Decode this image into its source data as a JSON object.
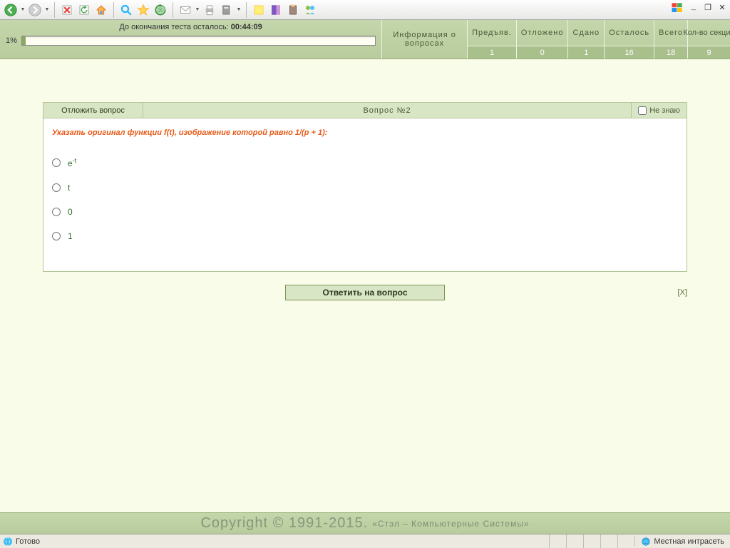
{
  "timer": {
    "label": "До окончания теста осталось: ",
    "value": "00:44:09",
    "percent": "1%"
  },
  "info_label": "Информация о вопросах",
  "stats": {
    "cols": [
      {
        "label": "Предъяв.",
        "value": "1"
      },
      {
        "label": "Отложено",
        "value": "0"
      },
      {
        "label": "Сдано",
        "value": "1"
      },
      {
        "label": "Осталось",
        "value": "16"
      },
      {
        "label": "Всего",
        "value": "18"
      }
    ],
    "sections": {
      "label": "Кол-во секций",
      "value": "9"
    }
  },
  "question": {
    "postpone": "Отложить вопрос",
    "title": "Вопрос №2",
    "dontknow": "Не знаю",
    "prompt": "Указать оригинал функции f(t), изображение которой равно 1/(p + 1):",
    "options": {
      "a_html": "e<sup>-t</sup>",
      "b": "t",
      "c": "0",
      "d": "1"
    },
    "submit": "Ответить на вопрос",
    "close": "[X]"
  },
  "copyright": {
    "main": "Copyright © 1991-2015.",
    "sub": "«Стэл – Компьютерные Системы»"
  },
  "statusbar": {
    "ready": "Готово",
    "zone": "Местная интрасеть"
  }
}
